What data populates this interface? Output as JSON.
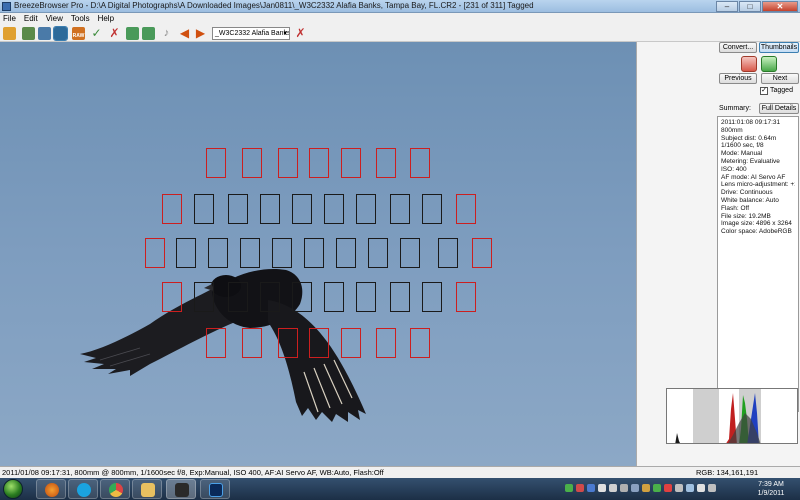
{
  "window": {
    "title": "BreezeBrowser Pro - D:\\A Digital Photographs\\A Downloaded Images\\Jan0811\\_W3C2332  Alafia Banks, Tampa Bay, FL.CR2 - [231 of 311] Tagged",
    "minimize": "–",
    "maximize": "□",
    "close": "✕"
  },
  "menu": [
    "File",
    "Edit",
    "View",
    "Tools",
    "Help"
  ],
  "toolbar": {
    "file_select": "_W3C2332  Alafia Banks",
    "raw_label": "RAW"
  },
  "sidebar": {
    "convert_label": "Convert...",
    "thumbnails_label": "Thumbnails",
    "previous_label": "Previous",
    "next_label": "Next",
    "tagged_label": "Tagged",
    "tagged_checked": true,
    "summary_label": "Summary:",
    "full_details_label": "Full Details",
    "details": [
      "2011:01:08 09:17:31",
      "800mm",
      "Subject dist: 0.64m",
      "1/1600 sec, f/8",
      "Mode: Manual",
      "Metering: Evaluative",
      "ISO: 400",
      "AF mode: AI Servo AF",
      "Lens micro-adjustment: +1",
      "Drive: Continuous",
      "White balance: Auto",
      "Flash: Off",
      "File size: 19.2MB",
      "Image size: 4896 x 3264",
      "Color space: AdobeRGB"
    ]
  },
  "status": {
    "info": "2011/01/08 09:17:31, 800mm @ 800mm, 1/1600sec f/8, Exp:Manual, ISO 400, AF:AI Servo AF, WB:Auto, Flash:Off",
    "rgb": "RGB: 134,161,191"
  },
  "taskbar": {
    "time": "7:39 AM",
    "date": "1/9/2011"
  },
  "colors": {
    "sky": "#7e9dbf",
    "af_active": "#cc1f1f",
    "af_inactive": "#1a1a1a",
    "accent": "#3c7fb1"
  }
}
